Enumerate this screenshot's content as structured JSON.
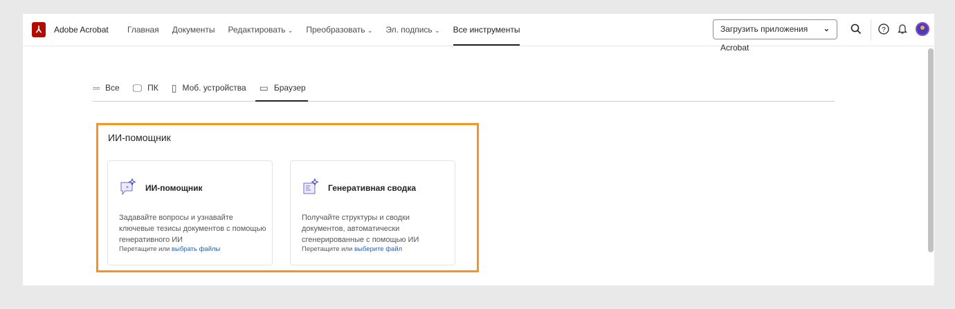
{
  "header": {
    "brand": "Adobe Acrobat",
    "nav": [
      "Главная",
      "Документы",
      "Редактировать",
      "Преобразовать",
      "Эл. подпись",
      "Все инструменты"
    ],
    "active_nav": 5,
    "download_button": "Загрузить приложения Acrobat"
  },
  "tabs": [
    {
      "label": "Все",
      "icon": "grid-icon"
    },
    {
      "label": "ПК",
      "icon": "desktop-icon"
    },
    {
      "label": "Моб. устройства",
      "icon": "mobile-icon"
    },
    {
      "label": "Браузер",
      "icon": "browser-icon"
    }
  ],
  "active_tab": 3,
  "section": {
    "title": "ИИ-помощник",
    "cards": [
      {
        "title": "ИИ-помощник",
        "description": "Задавайте вопросы и узнавайте ключевые тезисы документов с помощью генеративного ИИ",
        "drop_text": "Перетащите или",
        "link": "выбрать файлы"
      },
      {
        "title": "Генеративная сводка",
        "description": "Получайте структуры и сводки документов, автоматически сгенерированные с помощью ИИ",
        "drop_text": "Перетащите или",
        "link": "выберите файл"
      }
    ]
  },
  "colors": {
    "highlight": "#f7941d",
    "link": "#2d5fb5",
    "brand": "#b30b00"
  }
}
